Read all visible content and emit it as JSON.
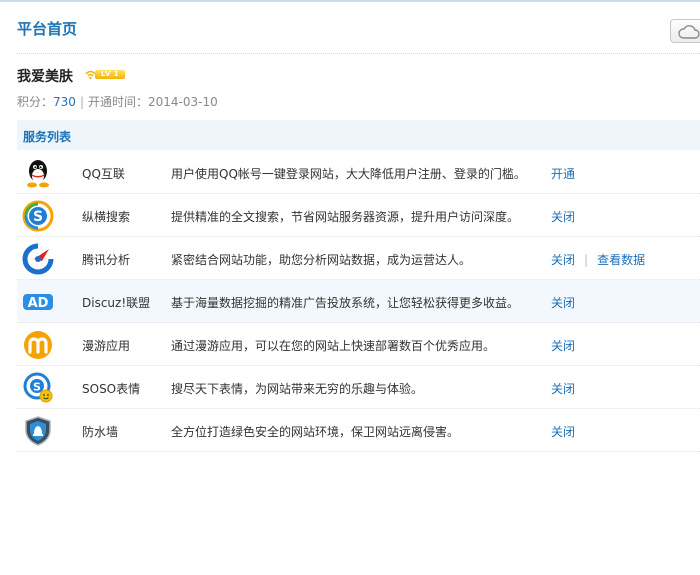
{
  "header": {
    "title": "平台首页"
  },
  "site": {
    "name": "我爱美肤",
    "level_label": "LV 1",
    "points_label": "积分",
    "points_value": "730",
    "open_time_label": "开通时间",
    "open_time_value": "2014-03-10"
  },
  "services": {
    "heading": "服务列表",
    "items": [
      {
        "icon": "qq-penguin-icon",
        "name": "QQ互联",
        "desc": "用户使用QQ帐号一键登录网站，大大降低用户注册、登录的门槛。",
        "actions": [
          "开通"
        ]
      },
      {
        "icon": "soso-search-icon",
        "name": "纵横搜索",
        "desc": "提供精准的全文搜索，节省网站服务器资源，提升用户访问深度。",
        "actions": [
          "关闭"
        ]
      },
      {
        "icon": "tencent-analytics-icon",
        "name": "腾讯分析",
        "desc": "紧密结合网站功能，助您分析网站数据，成为运营达人。",
        "actions": [
          "关闭",
          "查看数据"
        ]
      },
      {
        "icon": "ad-union-icon",
        "name": "Discuz!联盟",
        "desc": "基于海量数据挖掘的精准广告投放系统，让您轻松获得更多收益。",
        "actions": [
          "关闭"
        ]
      },
      {
        "icon": "manyou-app-icon",
        "name": "漫游应用",
        "desc": "通过漫游应用，可以在您的网站上快速部署数百个优秀应用。",
        "actions": [
          "关闭"
        ]
      },
      {
        "icon": "soso-emoticon-icon",
        "name": "SOSO表情",
        "desc": "搜尽天下表情，为网站带来无穷的乐趣与体验。",
        "actions": [
          "关闭"
        ]
      },
      {
        "icon": "firewall-shield-icon",
        "name": "防水墙",
        "desc": "全方位打造绿色安全的网站环境，保卫网站远离侵害。",
        "actions": [
          "关闭"
        ]
      }
    ]
  },
  "colors": {
    "accent": "#1d73b8",
    "link": "#1d6fb5",
    "header_bg": "#eef6fc"
  }
}
